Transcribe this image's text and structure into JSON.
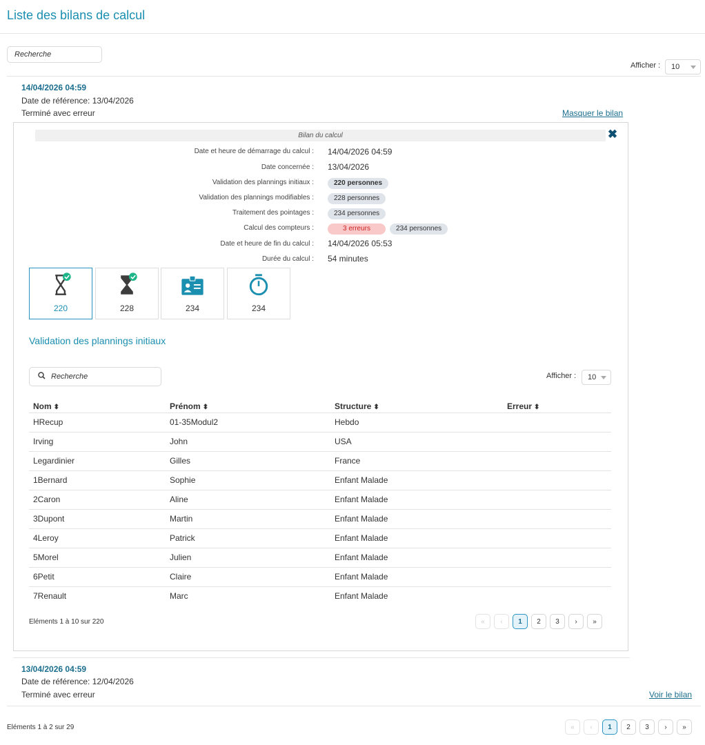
{
  "page": {
    "title": "Liste des bilans de calcul",
    "search_placeholder": "Recherche",
    "afficher_label": "Afficher :",
    "page_size": "10"
  },
  "bilans": [
    {
      "datetime": "14/04/2026 04:59",
      "reference": "Date de référence: 13/04/2026",
      "status": "Terminé avec erreur",
      "toggle_label": "Masquer le bilan"
    },
    {
      "datetime": "13/04/2026 04:59",
      "reference": "Date de référence: 12/04/2026",
      "status": "Terminé avec erreur",
      "toggle_label": "Voir le bilan"
    }
  ],
  "panel": {
    "header": "Bilan du calcul",
    "rows": [
      {
        "label": "Date et heure de démarrage du calcul :",
        "value": "14/04/2026 04:59"
      },
      {
        "label": "Date concernée :",
        "value": "13/04/2026"
      },
      {
        "label": "Validation des plannings initiaux :",
        "pill": "220 personnes"
      },
      {
        "label": "Validation des plannings modifiables :",
        "pill": "228 personnes"
      },
      {
        "label": "Traitement des pointages :",
        "pill": "234 personnes"
      },
      {
        "label": "Calcul des compteurs :",
        "error_pill": "3 erreurs",
        "pill": "234 personnes"
      },
      {
        "label": "Date et heure de fin du calcul :",
        "value": "14/04/2026 05:53"
      },
      {
        "label": "Durée du calcul :",
        "value": "54 minutes"
      }
    ],
    "tiles": [
      {
        "icon": "hourglass-outline-check-icon",
        "count": "220",
        "active": true
      },
      {
        "icon": "hourglass-filled-check-icon",
        "count": "228",
        "active": false
      },
      {
        "icon": "badge-card-icon",
        "count": "234",
        "active": false
      },
      {
        "icon": "stopwatch-icon",
        "count": "234",
        "active": false
      }
    ],
    "section_title": "Validation des plannings initiaux",
    "search_placeholder": "Recherche",
    "afficher_label": "Afficher :",
    "page_size": "10",
    "columns": [
      "Nom",
      "Prénom",
      "Structure",
      "Erreur"
    ],
    "table": [
      [
        "HRecup",
        "01-35Modul2",
        "Hebdo",
        ""
      ],
      [
        "Irving",
        "John",
        "USA",
        ""
      ],
      [
        "Legardinier",
        "Gilles",
        "France",
        ""
      ],
      [
        "1Bernard",
        "Sophie",
        "Enfant Malade",
        ""
      ],
      [
        "2Caron",
        "Aline",
        "Enfant Malade",
        ""
      ],
      [
        "3Dupont",
        "Martin",
        "Enfant Malade",
        ""
      ],
      [
        "4Leroy",
        "Patrick",
        "Enfant Malade",
        ""
      ],
      [
        "5Morel",
        "Julien",
        "Enfant Malade",
        ""
      ],
      [
        "6Petit",
        "Claire",
        "Enfant Malade",
        ""
      ],
      [
        "7Renault",
        "Marc",
        "Enfant Malade",
        ""
      ]
    ],
    "count_label": "Eléments 1 à 10 sur 220",
    "pagination": [
      "«",
      "‹",
      "1",
      "2",
      "3",
      "›",
      "»"
    ]
  },
  "footer": {
    "count_label": "Eléments 1 à 2 sur 29",
    "pagination": [
      "«",
      "‹",
      "1",
      "2",
      "3",
      "›",
      "»"
    ]
  },
  "colors": {
    "accent": "#1a8fb0",
    "link": "#1b6e8e",
    "check": "#1fb58a",
    "error_bg": "#f9c9c9",
    "icon_dark": "#3d3d3d",
    "icon_blue": "#1a8fb0"
  }
}
